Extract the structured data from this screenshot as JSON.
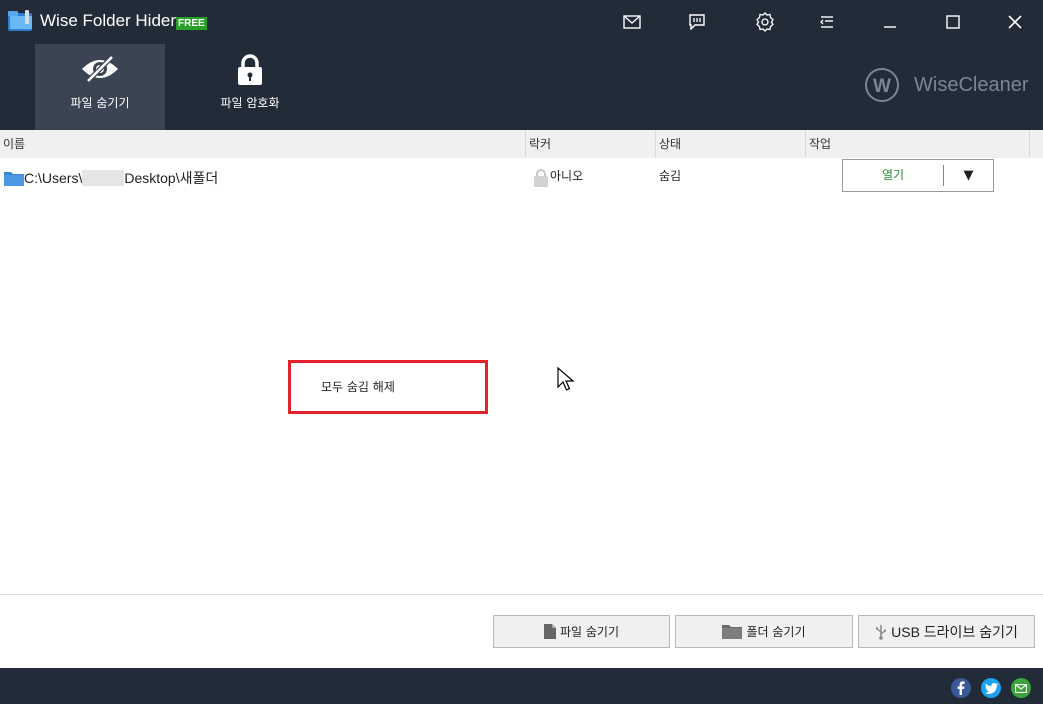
{
  "window": {
    "title": "Wise Folder Hider",
    "badge": "FREE",
    "controls": [
      "mail-icon",
      "feedback-icon",
      "settings-icon",
      "menu-icon",
      "minimize-icon",
      "maximize-icon",
      "close-icon"
    ]
  },
  "nav": {
    "tabs": [
      {
        "label": "파일 숨기기",
        "icon": "eye-slash-icon",
        "active": true
      },
      {
        "label": "파일 암호화",
        "icon": "lock-icon",
        "active": false
      }
    ]
  },
  "brand": {
    "name": "WiseCleaner",
    "logo_letter": "W"
  },
  "table": {
    "columns": [
      "이름",
      "락커",
      "상태",
      "작업"
    ],
    "rows": [
      {
        "path_prefix": "C:\\Users\\",
        "path_suffix": "Desktop\\새폴더",
        "locker": "아니오",
        "status": "숨김",
        "action": "열기",
        "action_dropdown": "▼"
      }
    ]
  },
  "context_menu": {
    "items": [
      "모두 숨김 해제"
    ]
  },
  "bottom_buttons": [
    {
      "label": "파일 숨기기",
      "icon": "file-icon"
    },
    {
      "label": "폴더 숨기기",
      "icon": "folder-icon"
    },
    {
      "label": "USB 드라이브 숨기기",
      "icon": "usb-icon"
    }
  ],
  "footer": {
    "social": [
      "facebook-icon",
      "twitter-icon",
      "email-icon"
    ],
    "colors": {
      "facebook": "#3b5998",
      "twitter": "#1da1f2",
      "email": "#3aa53a"
    }
  },
  "colors": {
    "header_bg": "#222b38",
    "active_tab_bg": "#3b4452",
    "free_badge": "#2aa02a",
    "action_text": "#1e8a2c",
    "highlight_border": "#e0242a"
  }
}
